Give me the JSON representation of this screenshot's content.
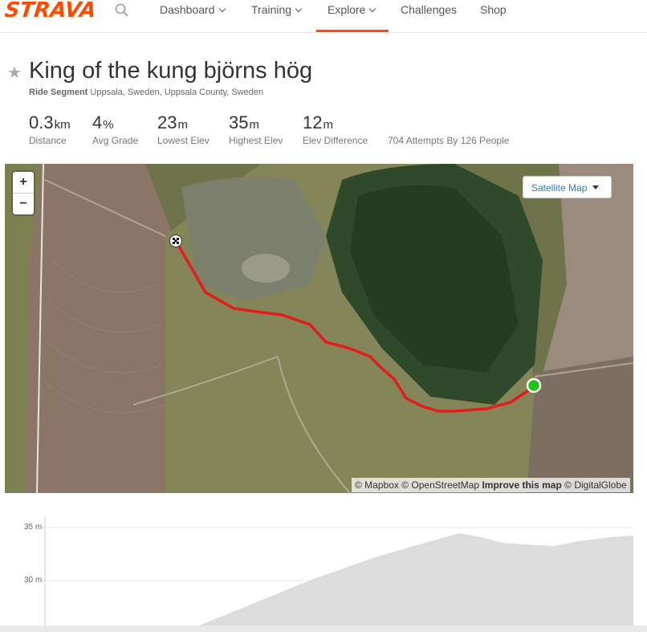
{
  "nav": {
    "logo": "STRAVA",
    "items": [
      {
        "label": "Dashboard",
        "dropdown": true
      },
      {
        "label": "Training",
        "dropdown": true
      },
      {
        "label": "Explore",
        "dropdown": true,
        "active": true
      },
      {
        "label": "Challenges",
        "dropdown": false
      },
      {
        "label": "Shop",
        "dropdown": false
      }
    ],
    "accent_color": "#fc4c02"
  },
  "segment": {
    "title": "King of the kung björns hög",
    "type": "Ride Segment",
    "location": "Uppsala, Sweden, Uppsala County, Sweden",
    "stats": [
      {
        "value": "0.3",
        "unit": "km",
        "label": "Distance"
      },
      {
        "value": "4",
        "unit": "%",
        "label": "Avg Grade"
      },
      {
        "value": "23",
        "unit": "m",
        "label": "Lowest Elev"
      },
      {
        "value": "35",
        "unit": "m",
        "label": "Highest Elev"
      },
      {
        "value": "12",
        "unit": "m",
        "label": "Elev Difference"
      }
    ],
    "attempts": "704 Attempts By 126 People"
  },
  "map": {
    "zoom_in": "+",
    "zoom_out": "−",
    "layer_button": "Satellite Map",
    "attribution": {
      "mapbox": "© Mapbox",
      "osm": "© OpenStreetMap",
      "improve": "Improve this map",
      "digitalglobe": "© DigitalGlobe"
    },
    "route_color": "#e31c1c",
    "start_color": "#1ec31e"
  },
  "elevation": {
    "y_labels": [
      "35 m",
      "30 m"
    ],
    "fill_color": "#dcdcdc"
  }
}
